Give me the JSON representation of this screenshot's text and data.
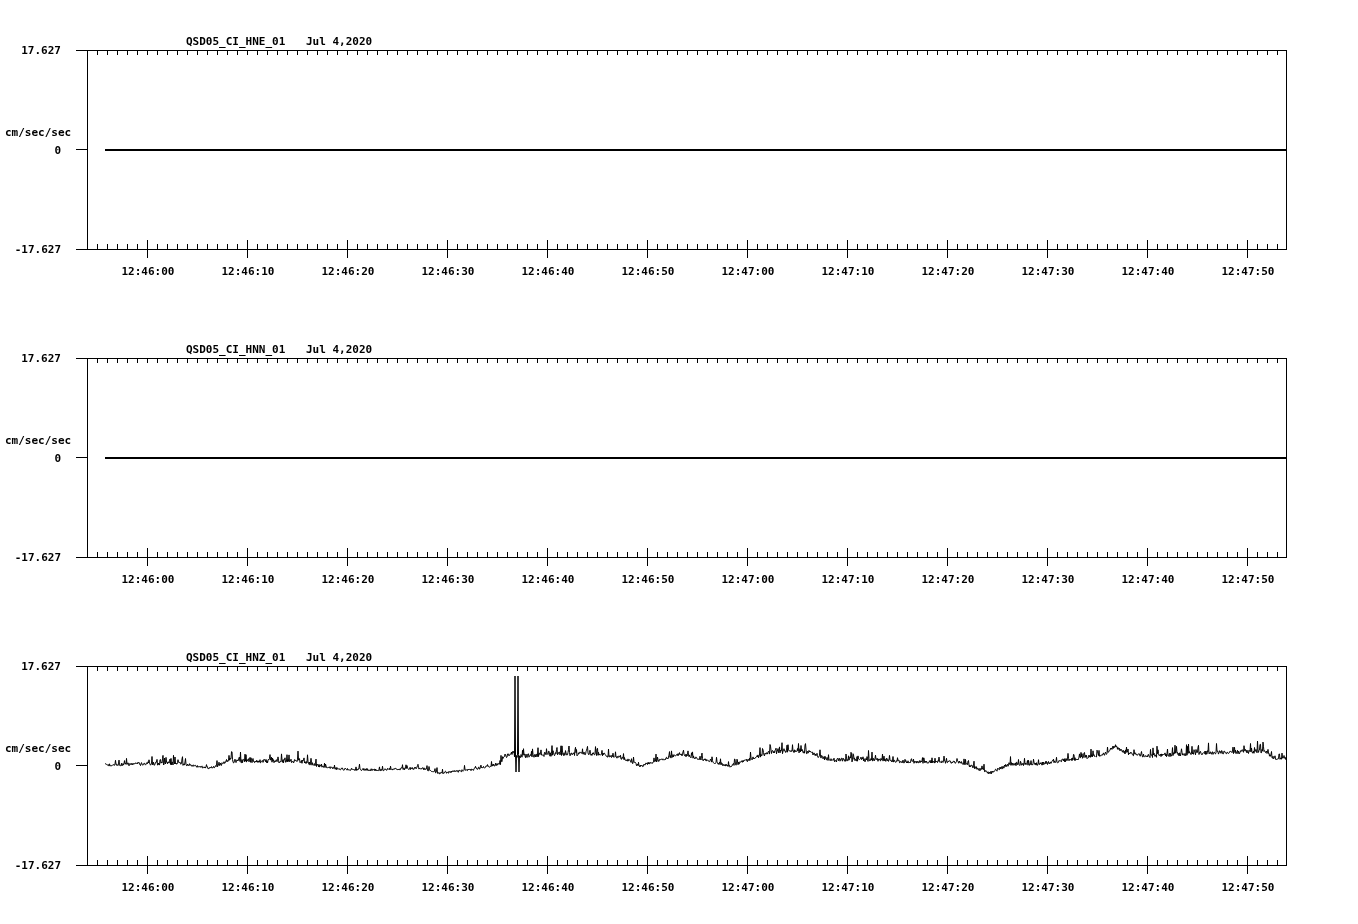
{
  "panels": [
    {
      "kind": "flat",
      "station": "QSD05_CI_HNE_01",
      "date": "Jul 4,2020",
      "ylabel": "cm/sec/sec",
      "yticks": [
        "17.627",
        "0",
        "-17.627"
      ],
      "xticks": [
        "12:46:00",
        "12:46:10",
        "12:46:20",
        "12:46:30",
        "12:46:40",
        "12:46:50",
        "12:47:00",
        "12:47:10",
        "12:47:20",
        "12:47:30",
        "12:47:40",
        "12:47:50"
      ]
    },
    {
      "kind": "flat",
      "station": "QSD05_CI_HNN_01",
      "date": "Jul 4,2020",
      "ylabel": "cm/sec/sec",
      "yticks": [
        "17.627",
        "0",
        "-17.627"
      ],
      "xticks": [
        "12:46:00",
        "12:46:10",
        "12:46:20",
        "12:46:30",
        "12:46:40",
        "12:46:50",
        "12:47:00",
        "12:47:10",
        "12:47:20",
        "12:47:30",
        "12:47:40",
        "12:47:50"
      ]
    },
    {
      "kind": "signal",
      "station": "QSD05_CI_HNZ_01",
      "date": "Jul 4,2020",
      "ylabel": "cm/sec/sec",
      "yticks": [
        "17.627",
        "0",
        "-17.627"
      ],
      "xticks": [
        "12:46:00",
        "12:46:10",
        "12:46:20",
        "12:46:30",
        "12:46:40",
        "12:46:50",
        "12:47:00",
        "12:47:10",
        "12:47:20",
        "12:47:30",
        "12:47:40",
        "12:47:50"
      ]
    }
  ]
}
